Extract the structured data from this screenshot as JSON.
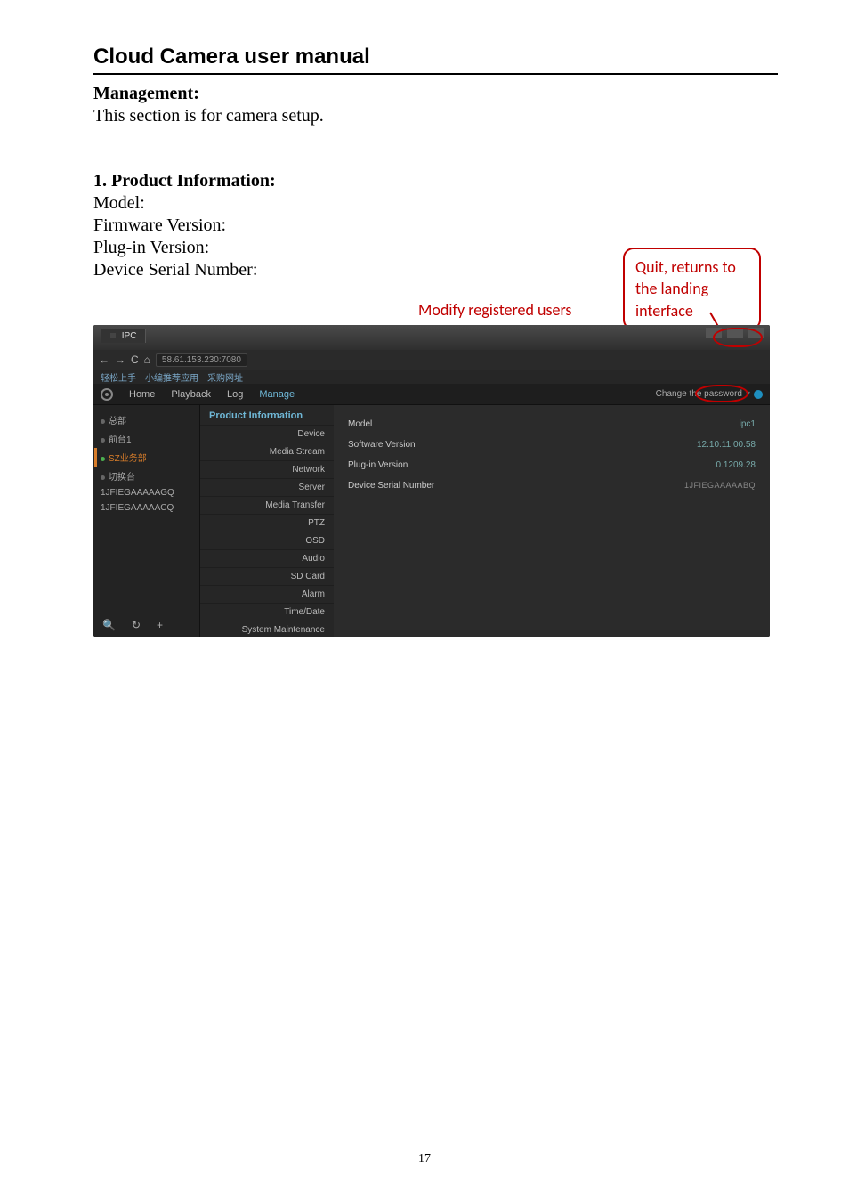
{
  "doc": {
    "title": "Cloud Camera user manual",
    "mgmt_heading": "Management:",
    "mgmt_text": "This section is for camera setup.",
    "section1_heading": "1. Product Information:",
    "line_model": "Model:",
    "line_fw": "Firmware Version:",
    "line_plugin": "Plug-in Version:",
    "line_serial": "Device Serial Number:",
    "page_number": "17"
  },
  "callouts": {
    "quit": "Quit, returns to the landing interface",
    "modify": "Modify registered users password"
  },
  "browser": {
    "tab_title": "IPC",
    "url": "58.61.153.230:7080",
    "bookmarks": [
      "轻松上手",
      "小编推荐应用",
      "采购网址"
    ]
  },
  "topnav": {
    "items": [
      "Home",
      "Playback",
      "Log",
      "Manage"
    ],
    "active_index": 3,
    "change_pwd": "Change the password",
    "exit_icon_name": "exit-icon"
  },
  "tree": {
    "items": [
      {
        "label": "总部",
        "online": false
      },
      {
        "label": "前台1",
        "online": false
      },
      {
        "label": "SZ业务部",
        "online": true,
        "selected": true
      },
      {
        "label": "切换台",
        "online": false
      },
      {
        "label": "1JFIEGAAAAAGQ",
        "online": false
      },
      {
        "label": "1JFIEGAAAAACQ",
        "online": false
      }
    ],
    "footer_icons": [
      "search-icon",
      "refresh-icon",
      "add-icon"
    ]
  },
  "menu": {
    "heading": "Product Information",
    "items": [
      "Device",
      "Media Stream",
      "Network",
      "Server",
      "Media Transfer",
      "PTZ",
      "OSD",
      "Audio",
      "SD Card",
      "Alarm",
      "Time/Date",
      "System Maintenance"
    ]
  },
  "info": {
    "rows": [
      {
        "label": "Model",
        "value": "ipc1",
        "cls": "val"
      },
      {
        "label": "Software Version",
        "value": "12.10.11.00.58",
        "cls": "val"
      },
      {
        "label": "Plug-in Version",
        "value": "0.1209.28",
        "cls": "val"
      },
      {
        "label": "Device Serial Number",
        "value": "1JFIEGAAAAABQ",
        "cls": "valg"
      }
    ]
  }
}
